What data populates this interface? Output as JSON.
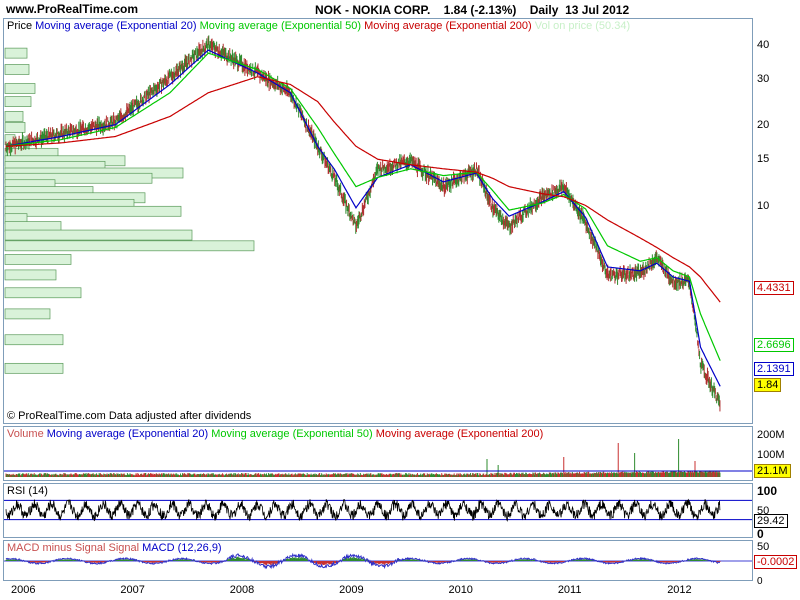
{
  "site": "www.ProRealTime.com",
  "header": {
    "title": "NOK - NOKIA CORP.    1.84 (-2.13%)    Daily  13 Jul 2012"
  },
  "price_panel": {
    "legend": {
      "price": "Price",
      "ema20": "Moving average (Exponential 20)",
      "ema50": "Moving average (Exponential 50)",
      "ema200": "Moving average (Exponential 200)",
      "vol_on_price": "Vol on price (50.34)"
    },
    "footnote": "© ProRealTime.com  Data adjusted after dividends",
    "values": {
      "ema200": "4.4331",
      "ema50": "2.6696",
      "ema20": "2.1391",
      "last": "1.84"
    },
    "colors": {
      "ema200": "#c80000",
      "ema50": "#00c800",
      "ema20": "#0000c8",
      "last_bg": "#ffff00"
    }
  },
  "volume_panel": {
    "legend": {
      "volume": "Volume",
      "ema20": "Moving average (Exponential 20)",
      "ema50": "Moving average (Exponential 50)",
      "ema200": "Moving average (Exponential 200)"
    },
    "last": "21.1M"
  },
  "rsi_panel": {
    "legend": "RSI (14)",
    "last": "29.42"
  },
  "macd_panel": {
    "legend_a": "MACD minus Signal Signal",
    "legend_b": "MACD (12,26,9)",
    "last": "-0.0002"
  },
  "chart_data": [
    {
      "type": "line",
      "name": "price",
      "scale": "log",
      "x": [
        "2006",
        "2007",
        "2008",
        "2009",
        "2010",
        "2011",
        "2012"
      ],
      "y_ticks": [
        40,
        30,
        20,
        15,
        10,
        5
      ],
      "ylim": [
        1.7,
        46
      ],
      "series": [
        {
          "name": "Price",
          "values": [
            [
              2006.0,
              17
            ],
            [
              2006.5,
              19
            ],
            [
              2007.0,
              21
            ],
            [
              2007.5,
              31
            ],
            [
              2007.85,
              41
            ],
            [
              2008.3,
              32
            ],
            [
              2008.6,
              27
            ],
            [
              2008.85,
              17
            ],
            [
              2009.0,
              13
            ],
            [
              2009.2,
              8.5
            ],
            [
              2009.4,
              14
            ],
            [
              2009.7,
              15
            ],
            [
              2010.0,
              12
            ],
            [
              2010.3,
              14
            ],
            [
              2010.45,
              10
            ],
            [
              2010.6,
              8.5
            ],
            [
              2010.9,
              11
            ],
            [
              2011.1,
              12
            ],
            [
              2011.3,
              8.8
            ],
            [
              2011.5,
              5.6
            ],
            [
              2011.8,
              5.7
            ],
            [
              2011.95,
              6.5
            ],
            [
              2012.1,
              5.3
            ],
            [
              2012.25,
              5.3
            ],
            [
              2012.35,
              2.6
            ],
            [
              2012.53,
              1.84
            ]
          ]
        },
        {
          "name": "Moving average (Exponential 20)",
          "values": [
            [
              2006.0,
              17
            ],
            [
              2006.5,
              18.5
            ],
            [
              2007.0,
              20.5
            ],
            [
              2007.5,
              29
            ],
            [
              2007.85,
              39
            ],
            [
              2008.3,
              32
            ],
            [
              2008.6,
              27
            ],
            [
              2008.85,
              17
            ],
            [
              2009.0,
              14
            ],
            [
              2009.2,
              10
            ],
            [
              2009.4,
              13
            ],
            [
              2009.7,
              14.5
            ],
            [
              2010.0,
              12.5
            ],
            [
              2010.3,
              13.5
            ],
            [
              2010.45,
              10.8
            ],
            [
              2010.6,
              9.3
            ],
            [
              2010.9,
              10.5
            ],
            [
              2011.1,
              11.5
            ],
            [
              2011.3,
              9.2
            ],
            [
              2011.5,
              6.0
            ],
            [
              2011.8,
              5.8
            ],
            [
              2011.95,
              6.2
            ],
            [
              2012.1,
              5.5
            ],
            [
              2012.25,
              5.3
            ],
            [
              2012.35,
              3.0
            ],
            [
              2012.53,
              2.14
            ]
          ]
        },
        {
          "name": "Moving average (Exponential 50)",
          "values": [
            [
              2006.0,
              17
            ],
            [
              2006.5,
              18
            ],
            [
              2007.0,
              20
            ],
            [
              2007.5,
              27
            ],
            [
              2007.85,
              38
            ],
            [
              2008.3,
              33
            ],
            [
              2008.6,
              28
            ],
            [
              2008.85,
              20
            ],
            [
              2009.0,
              16
            ],
            [
              2009.2,
              12
            ],
            [
              2009.4,
              13
            ],
            [
              2009.7,
              14
            ],
            [
              2010.0,
              13.2
            ],
            [
              2010.3,
              13.6
            ],
            [
              2010.45,
              11.6
            ],
            [
              2010.6,
              9.8
            ],
            [
              2010.9,
              10.4
            ],
            [
              2011.1,
              11.2
            ],
            [
              2011.3,
              9.9
            ],
            [
              2011.5,
              7.2
            ],
            [
              2011.8,
              6.3
            ],
            [
              2011.95,
              6.5
            ],
            [
              2012.1,
              5.8
            ],
            [
              2012.25,
              5.5
            ],
            [
              2012.35,
              4.0
            ],
            [
              2012.53,
              2.67
            ]
          ]
        },
        {
          "name": "Moving average (Exponential 200)",
          "values": [
            [
              2006.0,
              17
            ],
            [
              2006.5,
              17.5
            ],
            [
              2007.0,
              18.5
            ],
            [
              2007.5,
              22
            ],
            [
              2007.85,
              27
            ],
            [
              2008.3,
              31
            ],
            [
              2008.6,
              29
            ],
            [
              2008.85,
              25
            ],
            [
              2009.0,
              21
            ],
            [
              2009.2,
              17
            ],
            [
              2009.4,
              15.2
            ],
            [
              2009.7,
              14.5
            ],
            [
              2010.0,
              14
            ],
            [
              2010.3,
              13.6
            ],
            [
              2010.45,
              12.9
            ],
            [
              2010.6,
              12
            ],
            [
              2010.9,
              11.3
            ],
            [
              2011.1,
              11
            ],
            [
              2011.3,
              10.2
            ],
            [
              2011.5,
              9
            ],
            [
              2011.8,
              7.7
            ],
            [
              2011.95,
              7.1
            ],
            [
              2012.1,
              6.5
            ],
            [
              2012.25,
              6
            ],
            [
              2012.35,
              5.5
            ],
            [
              2012.53,
              4.43
            ]
          ]
        }
      ],
      "volume_profile": [
        {
          "price": 38,
          "value": 22
        },
        {
          "price": 33,
          "value": 24
        },
        {
          "price": 28,
          "value": 30
        },
        {
          "price": 25,
          "value": 26
        },
        {
          "price": 22,
          "value": 18
        },
        {
          "price": 20,
          "value": 20
        },
        {
          "price": 18,
          "value": 10
        },
        {
          "price": 16,
          "value": 53
        },
        {
          "price": 15,
          "value": 120
        },
        {
          "price": 14.3,
          "value": 100
        },
        {
          "price": 13.5,
          "value": 178
        },
        {
          "price": 12.9,
          "value": 147
        },
        {
          "price": 12.2,
          "value": 50
        },
        {
          "price": 11.5,
          "value": 88
        },
        {
          "price": 10.9,
          "value": 140
        },
        {
          "price": 10.3,
          "value": 129
        },
        {
          "price": 9.7,
          "value": 176
        },
        {
          "price": 9.1,
          "value": 22
        },
        {
          "price": 8.5,
          "value": 56
        },
        {
          "price": 7.9,
          "value": 187
        },
        {
          "price": 7.2,
          "value": 249
        },
        {
          "price": 6.4,
          "value": 66
        },
        {
          "price": 5.6,
          "value": 51
        },
        {
          "price": 4.8,
          "value": 76
        },
        {
          "price": 4.0,
          "value": 45
        },
        {
          "price": 3.2,
          "value": 58
        },
        {
          "price": 2.5,
          "value": 58
        }
      ]
    },
    {
      "type": "bar",
      "name": "volume",
      "y_ticks": [
        "200M",
        "100M"
      ],
      "ylim": [
        0,
        200
      ],
      "spikes": [
        [
          2010.4,
          90
        ],
        [
          2010.5,
          60
        ],
        [
          2011.1,
          100
        ],
        [
          2011.6,
          170
        ],
        [
          2011.75,
          120
        ],
        [
          2012.15,
          190
        ],
        [
          2012.3,
          80
        ]
      ],
      "baseline": 30
    },
    {
      "type": "line",
      "name": "rsi",
      "y_ticks": [
        100,
        50,
        0
      ],
      "ylim": [
        0,
        100
      ],
      "bands": [
        70,
        30
      ]
    },
    {
      "type": "line",
      "name": "macd",
      "y_ticks": [
        50,
        0
      ],
      "series": [
        {
          "name": "MACD (12,26,9)"
        },
        {
          "name": "MACD minus Signal Signal"
        }
      ]
    }
  ]
}
